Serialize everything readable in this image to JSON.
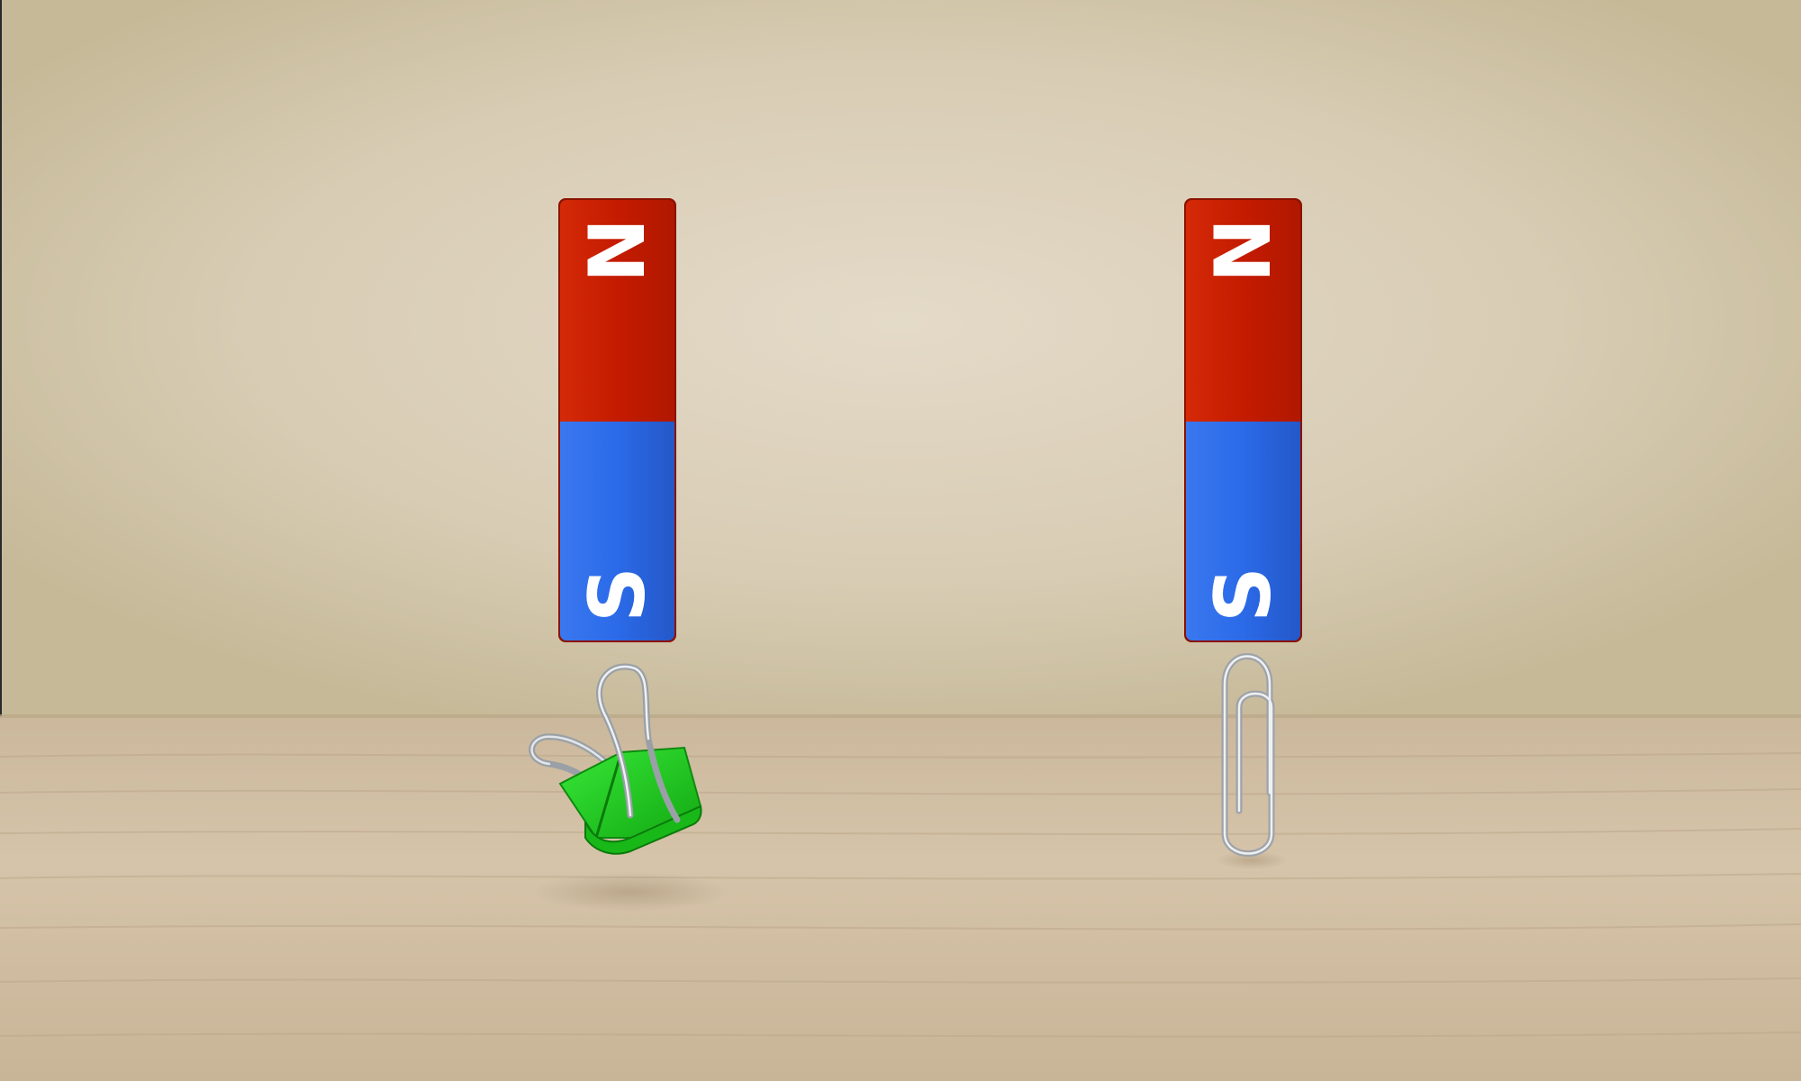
{
  "scene": {
    "colors": {
      "wall_center": "#e2d8c6",
      "wall_edge": "#c9bd9f",
      "table_top": "#d0bea4",
      "table_bottom": "#c2af92",
      "north_red": "#c41b00",
      "south_blue": "#2b6ae8",
      "pole_letter": "#ffffff",
      "clip_green": "#1fd01f",
      "metal_silver": "#b8bcc2"
    },
    "left_magnet": {
      "north_label": "N",
      "south_label": "S"
    },
    "right_magnet": {
      "north_label": "N",
      "south_label": "S"
    },
    "left_object": {
      "icon": "binder-clip-icon"
    },
    "right_object": {
      "icon": "paper-clip-icon"
    }
  }
}
